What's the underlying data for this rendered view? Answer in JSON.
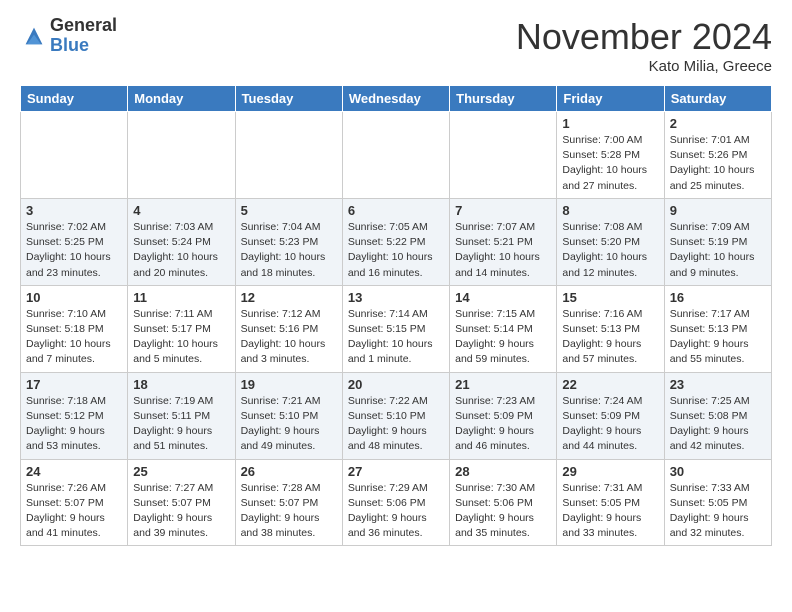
{
  "logo": {
    "general": "General",
    "blue": "Blue"
  },
  "title": "November 2024",
  "location": "Kato Milia, Greece",
  "weekdays": [
    "Sunday",
    "Monday",
    "Tuesday",
    "Wednesday",
    "Thursday",
    "Friday",
    "Saturday"
  ],
  "weeks": [
    [
      {
        "day": "",
        "info": ""
      },
      {
        "day": "",
        "info": ""
      },
      {
        "day": "",
        "info": ""
      },
      {
        "day": "",
        "info": ""
      },
      {
        "day": "",
        "info": ""
      },
      {
        "day": "1",
        "info": "Sunrise: 7:00 AM\nSunset: 5:28 PM\nDaylight: 10 hours and 27 minutes."
      },
      {
        "day": "2",
        "info": "Sunrise: 7:01 AM\nSunset: 5:26 PM\nDaylight: 10 hours and 25 minutes."
      }
    ],
    [
      {
        "day": "3",
        "info": "Sunrise: 7:02 AM\nSunset: 5:25 PM\nDaylight: 10 hours and 23 minutes."
      },
      {
        "day": "4",
        "info": "Sunrise: 7:03 AM\nSunset: 5:24 PM\nDaylight: 10 hours and 20 minutes."
      },
      {
        "day": "5",
        "info": "Sunrise: 7:04 AM\nSunset: 5:23 PM\nDaylight: 10 hours and 18 minutes."
      },
      {
        "day": "6",
        "info": "Sunrise: 7:05 AM\nSunset: 5:22 PM\nDaylight: 10 hours and 16 minutes."
      },
      {
        "day": "7",
        "info": "Sunrise: 7:07 AM\nSunset: 5:21 PM\nDaylight: 10 hours and 14 minutes."
      },
      {
        "day": "8",
        "info": "Sunrise: 7:08 AM\nSunset: 5:20 PM\nDaylight: 10 hours and 12 minutes."
      },
      {
        "day": "9",
        "info": "Sunrise: 7:09 AM\nSunset: 5:19 PM\nDaylight: 10 hours and 9 minutes."
      }
    ],
    [
      {
        "day": "10",
        "info": "Sunrise: 7:10 AM\nSunset: 5:18 PM\nDaylight: 10 hours and 7 minutes."
      },
      {
        "day": "11",
        "info": "Sunrise: 7:11 AM\nSunset: 5:17 PM\nDaylight: 10 hours and 5 minutes."
      },
      {
        "day": "12",
        "info": "Sunrise: 7:12 AM\nSunset: 5:16 PM\nDaylight: 10 hours and 3 minutes."
      },
      {
        "day": "13",
        "info": "Sunrise: 7:14 AM\nSunset: 5:15 PM\nDaylight: 10 hours and 1 minute."
      },
      {
        "day": "14",
        "info": "Sunrise: 7:15 AM\nSunset: 5:14 PM\nDaylight: 9 hours and 59 minutes."
      },
      {
        "day": "15",
        "info": "Sunrise: 7:16 AM\nSunset: 5:13 PM\nDaylight: 9 hours and 57 minutes."
      },
      {
        "day": "16",
        "info": "Sunrise: 7:17 AM\nSunset: 5:13 PM\nDaylight: 9 hours and 55 minutes."
      }
    ],
    [
      {
        "day": "17",
        "info": "Sunrise: 7:18 AM\nSunset: 5:12 PM\nDaylight: 9 hours and 53 minutes."
      },
      {
        "day": "18",
        "info": "Sunrise: 7:19 AM\nSunset: 5:11 PM\nDaylight: 9 hours and 51 minutes."
      },
      {
        "day": "19",
        "info": "Sunrise: 7:21 AM\nSunset: 5:10 PM\nDaylight: 9 hours and 49 minutes."
      },
      {
        "day": "20",
        "info": "Sunrise: 7:22 AM\nSunset: 5:10 PM\nDaylight: 9 hours and 48 minutes."
      },
      {
        "day": "21",
        "info": "Sunrise: 7:23 AM\nSunset: 5:09 PM\nDaylight: 9 hours and 46 minutes."
      },
      {
        "day": "22",
        "info": "Sunrise: 7:24 AM\nSunset: 5:09 PM\nDaylight: 9 hours and 44 minutes."
      },
      {
        "day": "23",
        "info": "Sunrise: 7:25 AM\nSunset: 5:08 PM\nDaylight: 9 hours and 42 minutes."
      }
    ],
    [
      {
        "day": "24",
        "info": "Sunrise: 7:26 AM\nSunset: 5:07 PM\nDaylight: 9 hours and 41 minutes."
      },
      {
        "day": "25",
        "info": "Sunrise: 7:27 AM\nSunset: 5:07 PM\nDaylight: 9 hours and 39 minutes."
      },
      {
        "day": "26",
        "info": "Sunrise: 7:28 AM\nSunset: 5:07 PM\nDaylight: 9 hours and 38 minutes."
      },
      {
        "day": "27",
        "info": "Sunrise: 7:29 AM\nSunset: 5:06 PM\nDaylight: 9 hours and 36 minutes."
      },
      {
        "day": "28",
        "info": "Sunrise: 7:30 AM\nSunset: 5:06 PM\nDaylight: 9 hours and 35 minutes."
      },
      {
        "day": "29",
        "info": "Sunrise: 7:31 AM\nSunset: 5:05 PM\nDaylight: 9 hours and 33 minutes."
      },
      {
        "day": "30",
        "info": "Sunrise: 7:33 AM\nSunset: 5:05 PM\nDaylight: 9 hours and 32 minutes."
      }
    ]
  ]
}
